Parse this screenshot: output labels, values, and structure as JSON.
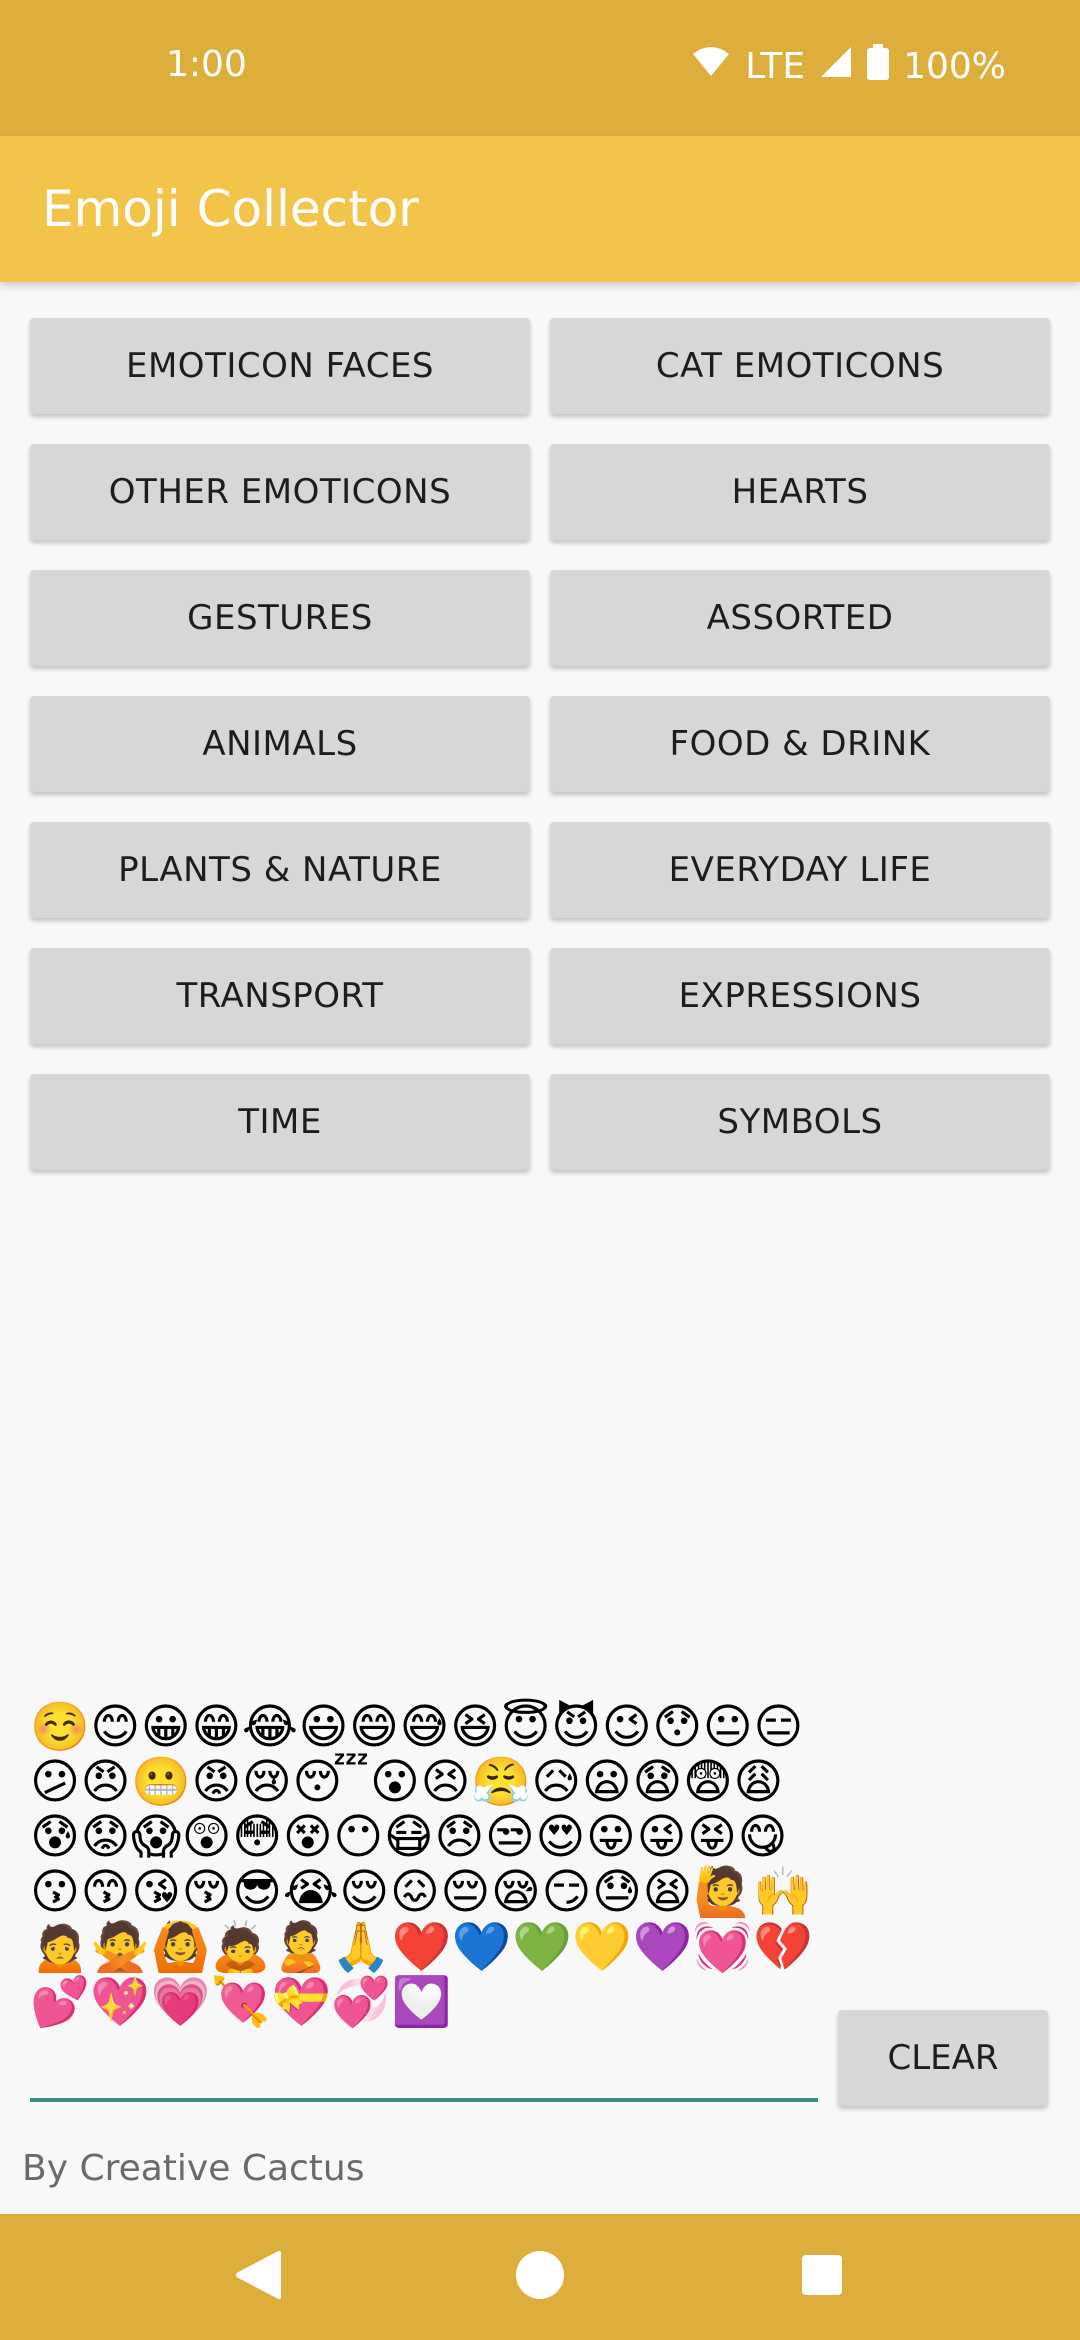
{
  "status_bar": {
    "time": "1:00",
    "network": "LTE",
    "battery": "100%"
  },
  "app_bar": {
    "title": "Emoji Collector"
  },
  "categories": [
    "EMOTICON FACES",
    "CAT EMOTICONS",
    "OTHER EMOTICONS",
    "HEARTS",
    "GESTURES",
    "ASSORTED",
    "ANIMALS",
    "FOOD & DRINK",
    "PLANTS & NATURE",
    "EVERYDAY LIFE",
    "TRANSPORT",
    "EXPRESSIONS",
    "TIME",
    "SYMBOLS"
  ],
  "emoji_field": {
    "value": "☺️😊😀😁😂😃😄😅😆😇😈😉😯😐😑😕😠😬😡😢😴😮😣😤😥😦😧😨😩😰😟😱😲😳😵😶😷😞😒😍😛😜😝😋😗😙😘😚😎😭😌😖😔😪😏😓😫🙋🙌🙍🙅🙆🙇🙎🙏❤️💙💚💛💜💓💔💕💖💗💘💝💞💟"
  },
  "clear_button": {
    "label": "CLEAR"
  },
  "footer": {
    "credit": "By Creative Cactus"
  },
  "colors": {
    "status_bar": "#ddae3c",
    "app_bar": "#f3c44a",
    "button": "#d6d7d7",
    "underline": "#3d8f83"
  },
  "icons": {
    "wifi": "wifi-icon",
    "signal": "signal-icon",
    "battery": "battery-icon",
    "back": "back-icon",
    "home": "home-icon",
    "recents": "recents-icon"
  }
}
